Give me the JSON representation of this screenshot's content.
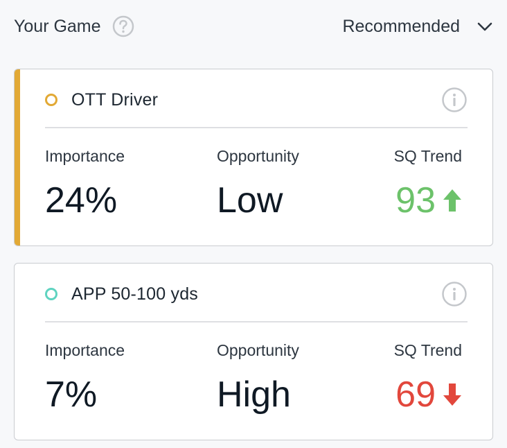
{
  "header": {
    "title": "Your Game",
    "sort_label": "Recommended"
  },
  "cards": [
    {
      "title": "OTT Driver",
      "dot_color": "#e2a935",
      "accent_color": "#e2a935",
      "importance_label": "Importance",
      "importance_value": "24%",
      "opportunity_label": "Opportunity",
      "opportunity_value": "Low",
      "sq_label": "SQ Trend",
      "sq_value": "93",
      "sq_direction": "up",
      "sq_color": "#6cc26a"
    },
    {
      "title": "APP 50-100 yds",
      "dot_color": "#5fd3c0",
      "importance_label": "Importance",
      "importance_value": "7%",
      "opportunity_label": "Opportunity",
      "opportunity_value": "High",
      "sq_label": "SQ Trend",
      "sq_value": "69",
      "sq_direction": "down",
      "sq_color": "#e2473c"
    }
  ],
  "icons": {
    "help": "question-circle-icon",
    "sort": "chevron-down-icon",
    "info": "info-circle-icon",
    "trend_up": "arrow-up-icon",
    "trend_down": "arrow-down-icon"
  }
}
